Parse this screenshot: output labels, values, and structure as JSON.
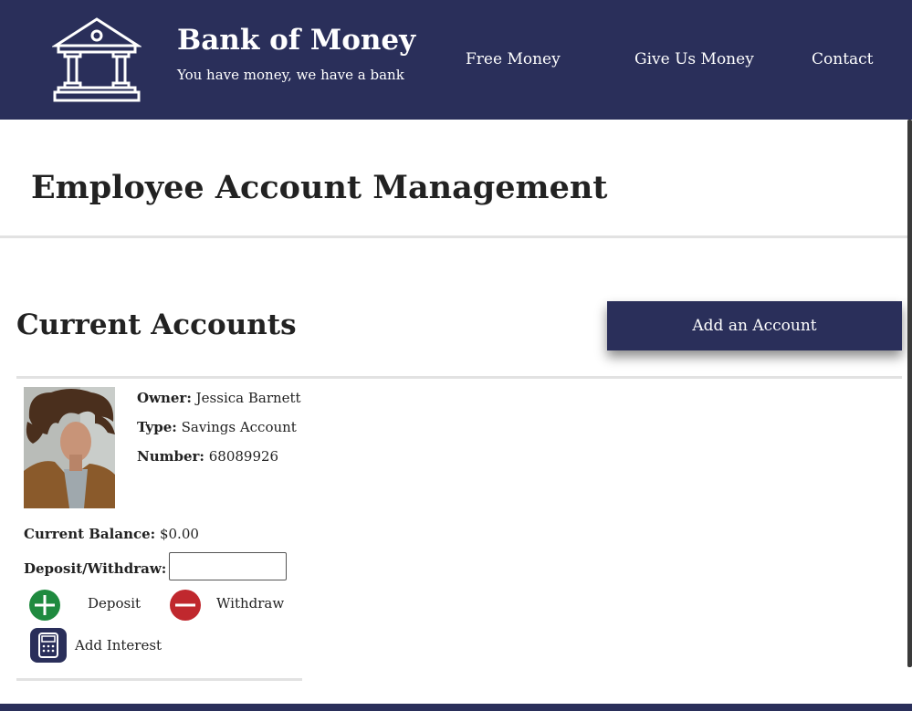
{
  "brand": {
    "title": "Bank of Money",
    "tagline": "You have money, we have a bank",
    "logo_icon": "bank-building-icon"
  },
  "nav": {
    "items": [
      {
        "label": "Free Money"
      },
      {
        "label": "Give Us Money"
      },
      {
        "label": "Contact"
      }
    ]
  },
  "page": {
    "title": "Employee Account Management"
  },
  "accounts_section": {
    "title": "Current Accounts",
    "add_button_label": "Add an Account"
  },
  "account": {
    "owner_label": "Owner:",
    "owner": "Jessica Barnett",
    "type_label": "Type:",
    "type": "Savings Account",
    "number_label": "Number:",
    "number": "68089926",
    "balance_label": "Current Balance:",
    "balance": "$0.00",
    "deposit_withdraw_label": "Deposit/Withdraw:",
    "amount_value": "",
    "deposit_label": "Deposit",
    "withdraw_label": "Withdraw",
    "interest_label": "Add Interest"
  },
  "colors": {
    "navy": "#2a2f5a",
    "deposit_green": "#1f8a3f",
    "withdraw_red": "#c0282e"
  }
}
